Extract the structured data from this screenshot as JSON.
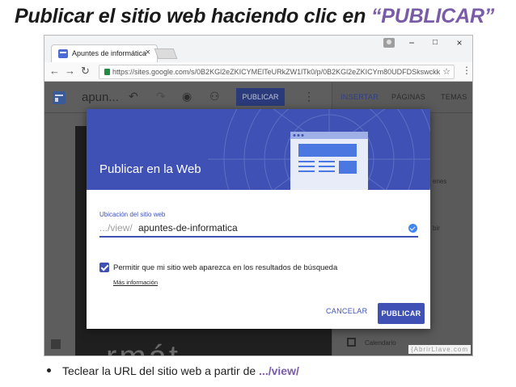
{
  "slide": {
    "title_prefix": "Publicar el sitio web haciendo clic en ",
    "title_accent": "“PUBLICAR”",
    "bullet_prefix": "Teclear la URL del sitio web a partir de ",
    "bullet_accent": ".../view/",
    "accent_color": "#7a5ba8"
  },
  "browser": {
    "tab_title": "Apuntes de informática",
    "tab_close": "×",
    "url": "https://sites.google.com/s/0B2KGl2eZKICYMElTeURkZW1lTk0/p/0B2KGl2eZKICYm80UDFDSkswckk",
    "window_minimize": "−",
    "window_maximize": "□",
    "window_close": "×"
  },
  "editor": {
    "site_name": "apun...",
    "publish_label": "PUBLICAR",
    "side_tabs": [
      "INSERTAR",
      "PÁGINAS",
      "TEMAS"
    ],
    "side_snippets": [
      "enes",
      "bir"
    ],
    "calendar_label": "Calendario",
    "canvas_text": "rmát",
    "watermark": "{AbrirLlave.com"
  },
  "dialog": {
    "title": "Publicar en la Web",
    "field_label": "Ubicación del sitio web",
    "field_prefix": ".../view/",
    "field_value": "apuntes-de-informatica",
    "checkbox_label": "Permitir que mi sitio web aparezca en los resultados de búsqueda",
    "checkbox_checked": true,
    "more_info": "Más información",
    "cancel_label": "CANCELAR",
    "publish_label": "PUBLICAR",
    "header_color": "#3f51b5"
  }
}
